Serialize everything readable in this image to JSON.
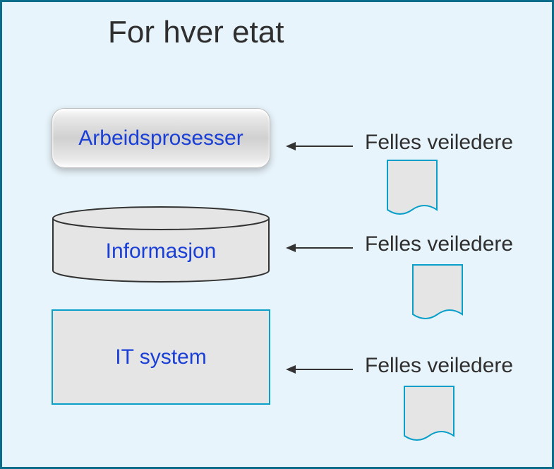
{
  "title": "For hver etat",
  "blocks": {
    "process": "Arbeidsprosesser",
    "information": "Informasjon",
    "system": "IT system"
  },
  "labels": {
    "guide1": "Felles veiledere",
    "guide2": "Felles veiledere",
    "guide3": "Felles veiledere"
  },
  "colors": {
    "frame_border": "#0a6e8a",
    "background": "#e8f4fb",
    "text_primary": "#2f2f2f",
    "text_link": "#1a3fd6",
    "shape_fill": "#e5e5e5",
    "shape_border_teal": "#0a9fc9"
  }
}
